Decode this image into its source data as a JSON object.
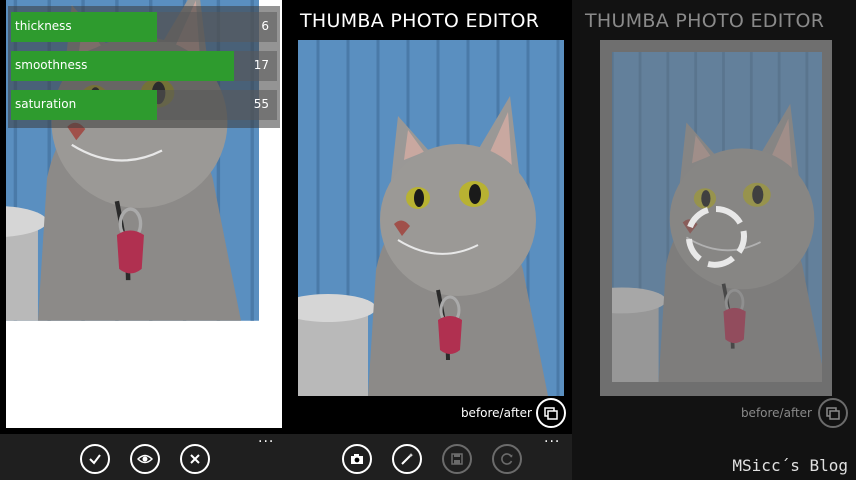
{
  "panel1": {
    "sliders": [
      {
        "label": "thickness",
        "value": "6",
        "fill_fraction": 0.55
      },
      {
        "label": "smoothness",
        "value": "17",
        "fill_fraction": 0.84
      },
      {
        "label": "saturation",
        "value": "55",
        "fill_fraction": 0.55
      }
    ],
    "appbar": {
      "buttons": [
        {
          "name": "accept",
          "icon": "check-icon"
        },
        {
          "name": "preview",
          "icon": "eye-icon"
        },
        {
          "name": "cancel",
          "icon": "close-icon"
        }
      ],
      "more": "..."
    }
  },
  "panel2": {
    "title": "THUMBA PHOTO EDITOR",
    "before_after_label": "before/after",
    "appbar": {
      "buttons": [
        {
          "name": "camera",
          "icon": "camera-icon",
          "enabled": true
        },
        {
          "name": "effects",
          "icon": "magic-wand-icon",
          "enabled": true
        },
        {
          "name": "save",
          "icon": "save-icon",
          "enabled": false
        },
        {
          "name": "share",
          "icon": "refresh-icon",
          "enabled": false
        }
      ],
      "more": "..."
    }
  },
  "panel3": {
    "title": "THUMBA PHOTO EDITOR",
    "before_after_label": "before/after"
  },
  "watermark": "MSicc´s Blog",
  "colors": {
    "slider_fill": "#2e9b2e",
    "appbar_bg": "#1f1f1f",
    "dim_text": "#8a8a8a"
  }
}
